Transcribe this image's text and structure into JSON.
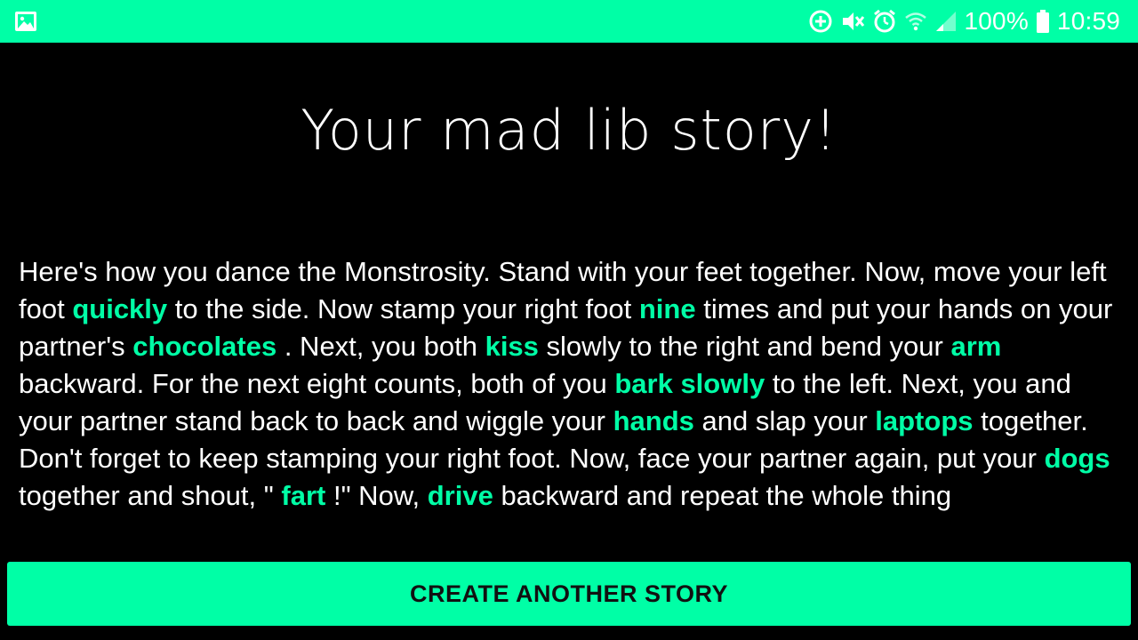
{
  "status_bar": {
    "battery_text": "100%",
    "time_text": "10:59",
    "icons": [
      "gallery-icon",
      "data-saver-icon",
      "mute-icon",
      "alarm-icon",
      "wifi-icon",
      "signal-icon",
      "battery-icon"
    ]
  },
  "title": "Your mad lib story!",
  "story": {
    "s1": "Here's how you dance the Monstrosity. Stand with your feet together. Now, move your left foot ",
    "w1": "quickly",
    "s2": " to the side. Now stamp your right foot ",
    "w2": "nine",
    "s3": " times and put your hands on your partner's ",
    "w3": "chocolates",
    "s4": " . Next, you both ",
    "w4": "kiss",
    "s5": " slowly to the right and bend your ",
    "w5": "arm",
    "s6": " backward. For the next eight counts, both of you ",
    "w6": "bark slowly",
    "s7": " to the left. Next, you and your partner stand back to back and wiggle your ",
    "w7": "hands",
    "s8": " and slap your ",
    "w8": "laptops",
    "s9": " together. Don't forget to keep stamping your right foot. Now, face your partner again, put your ",
    "w9": "dogs",
    "s10": " together and shout, \" ",
    "w10": "fart",
    "s11": " !\" Now, ",
    "w11": "drive",
    "s12": " backward and repeat the whole thing"
  },
  "button": {
    "label": "CREATE ANOTHER STORY"
  },
  "colors": {
    "accent": "#00FFA6",
    "background": "#000000",
    "text": "#FFFFFF"
  }
}
